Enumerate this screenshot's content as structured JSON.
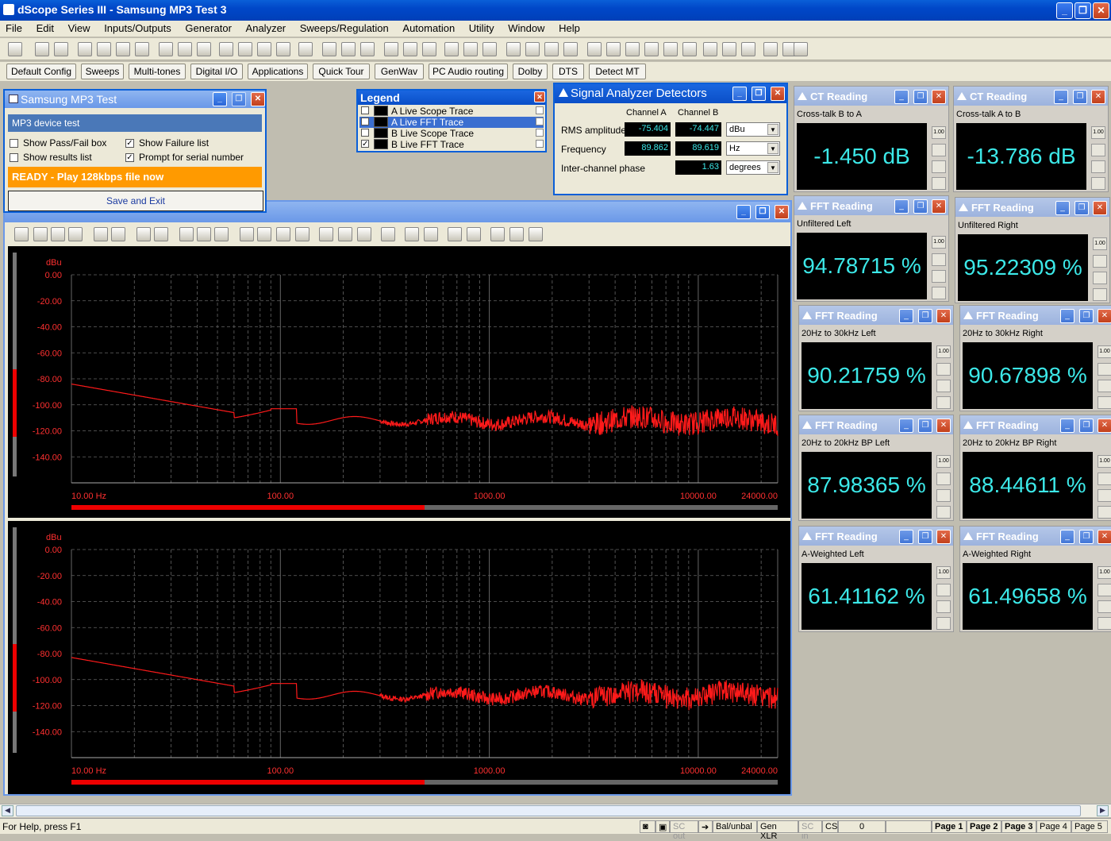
{
  "window": {
    "title": "dScope Series III - Samsung MP3 Test 3"
  },
  "menu": [
    "File",
    "Edit",
    "View",
    "Inputs/Outputs",
    "Generator",
    "Analyzer",
    "Sweeps/Regulation",
    "Automation",
    "Utility",
    "Window",
    "Help"
  ],
  "toolbar2": [
    "Default Config",
    "Sweeps",
    "Multi-tones",
    "Digital I/O",
    "Applications",
    "Quick Tour",
    "GenWav",
    "PC Audio routing",
    "Dolby",
    "DTS",
    "Detect MT"
  ],
  "test_panel": {
    "title": "Samsung MP3 Test",
    "heading": "MP3 device test",
    "checks": [
      {
        "label": "Show Pass/Fail box",
        "checked": false
      },
      {
        "label": "Show Failure list",
        "checked": true
      },
      {
        "label": "Show results list",
        "checked": false
      },
      {
        "label": "Prompt for serial number",
        "checked": true
      }
    ],
    "status": "READY - Play 128kbps file now",
    "button": "Save and Exit"
  },
  "legend": {
    "title": "Legend",
    "items": [
      {
        "label": "A Live Scope Trace",
        "checked": false
      },
      {
        "label": "A Live FFT Trace",
        "checked": true,
        "selected": true
      },
      {
        "label": "B Live Scope Trace",
        "checked": false
      },
      {
        "label": "B Live FFT Trace",
        "checked": true
      }
    ]
  },
  "detectors": {
    "title": "Signal Analyzer Detectors",
    "col_a": "Channel A",
    "col_b": "Channel B",
    "rows": [
      {
        "label": "RMS amplitude",
        "a": "-75.404",
        "b": "-74.447",
        "unit": "dBu"
      },
      {
        "label": "Frequency",
        "a": "89.862",
        "b": "89.619",
        "unit": "Hz"
      },
      {
        "label": "Inter-channel phase",
        "a": "",
        "b": "1.63",
        "unit": "degrees"
      }
    ]
  },
  "readings": [
    {
      "title": "CT Reading",
      "sub": "Cross-talk B to A",
      "value": "-1.450 dB"
    },
    {
      "title": "CT Reading",
      "sub": "Cross-talk A to B",
      "value": "-13.786 dB"
    },
    {
      "title": "FFT Reading",
      "sub": "Unfiltered Left",
      "value": "94.78715 %"
    },
    {
      "title": "FFT Reading",
      "sub": "Unfiltered Right",
      "value": "95.22309 %"
    },
    {
      "title": "FFT Reading",
      "sub": "20Hz to 30kHz Left",
      "value": "90.21759 %"
    },
    {
      "title": "FFT Reading",
      "sub": "20Hz to 30kHz Right",
      "value": "90.67898 %"
    },
    {
      "title": "FFT Reading",
      "sub": "20Hz to 20kHz BP Left",
      "value": "87.98365 %"
    },
    {
      "title": "FFT Reading",
      "sub": "20Hz to 20kHz BP Right",
      "value": "88.44611 %"
    },
    {
      "title": "FFT Reading",
      "sub": "A-Weighted Left",
      "value": "61.41162 %"
    },
    {
      "title": "FFT Reading",
      "sub": "A-Weighted Right",
      "value": "61.49658 %"
    }
  ],
  "reading_side_label": "1.00",
  "graph": {
    "yunit": "dBu",
    "yticks": [
      "0.00",
      "-20.00",
      "-40.00",
      "-60.00",
      "-80.00",
      "-100.00",
      "-120.00",
      "-140.00"
    ],
    "xticks": [
      "10.00 Hz",
      "100.00",
      "1000.00",
      "10000.00",
      "24000.00"
    ]
  },
  "statusbar": {
    "help": "For Help, press F1",
    "items": [
      "SC out",
      "Bal/unbal",
      "Gen XLR",
      "SC in",
      "CS",
      "0",
      "Page 1",
      "Page 2",
      "Page 3",
      "Page 4",
      "Page 5"
    ]
  },
  "colors": {
    "trace": "#ff1a1a",
    "readout": "#3ce8e8",
    "accent": "#0a5fd8",
    "ready": "#ff9a00"
  }
}
